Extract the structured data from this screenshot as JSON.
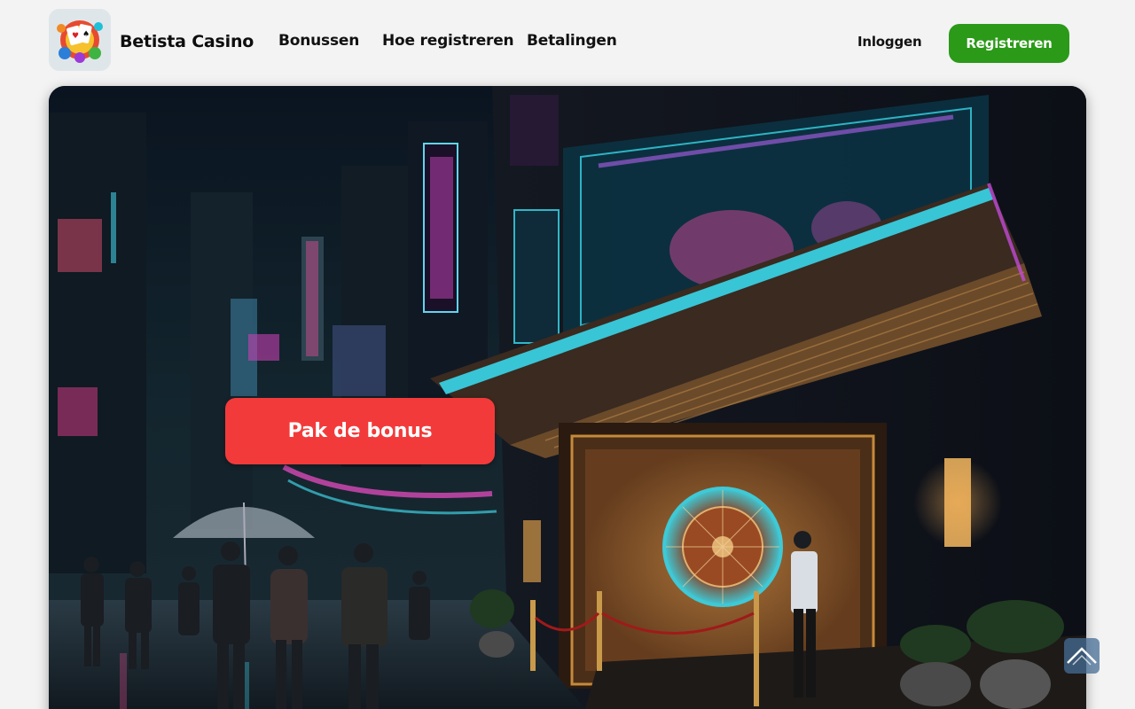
{
  "brand": {
    "name": "Betista Casino",
    "logo_icon": "casino-logo-icon"
  },
  "nav": {
    "items": [
      {
        "label": "Bonussen"
      },
      {
        "label": "Hoe registreren"
      },
      {
        "label": "Betalingen"
      }
    ]
  },
  "auth": {
    "login_label": "Inloggen",
    "register_label": "Registreren"
  },
  "hero": {
    "cta_label": "Pak de bonus",
    "scene": "neon-casino-street-night"
  },
  "scroll_top": {
    "icon": "chevron-up-icon"
  },
  "colors": {
    "register": "#2b9a18",
    "cta": "#f33a3a",
    "background": "#f3f3f3"
  }
}
